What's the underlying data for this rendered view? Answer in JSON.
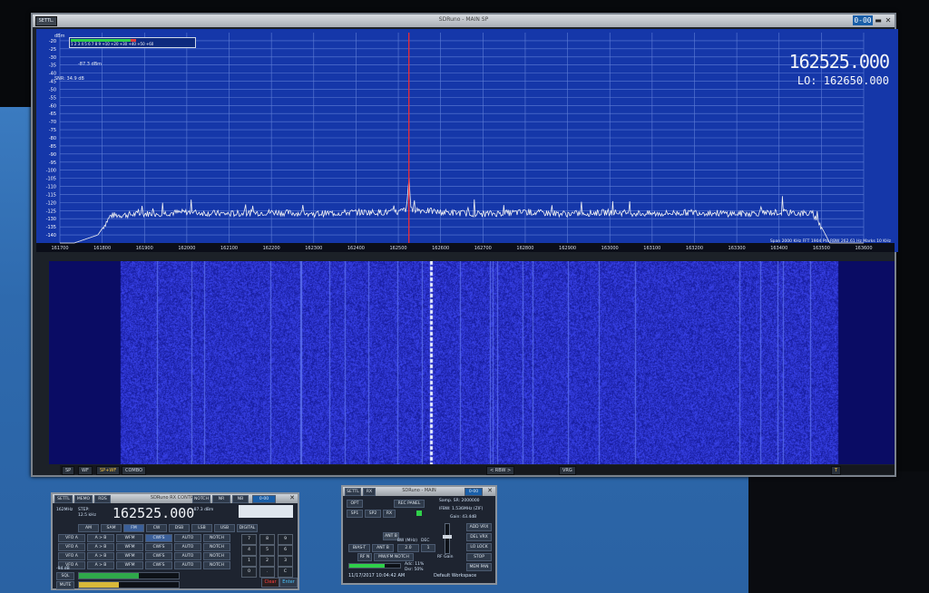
{
  "main_window": {
    "setup_label": "SETTL.",
    "title": "SDRuno - MAIN SP",
    "clock": "0-00",
    "center_freq": "162525.000",
    "lo_freq": "LO: 162650.000",
    "signal_dbm": "-87.3 dBm",
    "snr": "SNR: 34.9 dB",
    "smeter_label": "dBm",
    "smeter_scale": "1 2 3 4 5 6 7 8 9 +10 +20 +30 +40 +50 +60",
    "spectrum_info": "Span 2000 KHz   FFT 1904 Pts   RBW 262.61 Hz   Marks 10 KHz",
    "status": {
      "sp": "SP",
      "wf": "WF",
      "spwf": "SP+WF",
      "combo": "COMBO",
      "rbw": "< RBW >",
      "vrg": "VRG",
      "sp_mode": "SP+WF",
      "extra": "T"
    }
  },
  "chart_data": {
    "type": "line",
    "title": "",
    "xlabel": "",
    "ylabel": "dBm",
    "x_ticks": [
      161700,
      161800,
      161900,
      162000,
      162100,
      162200,
      162300,
      162400,
      162500,
      162600,
      162700,
      162800,
      162900,
      163000,
      163100,
      163200,
      163300,
      163400,
      163500,
      163600
    ],
    "y_ticks": [
      -20,
      -25,
      -30,
      -35,
      -40,
      -45,
      -50,
      -55,
      -60,
      -65,
      -70,
      -75,
      -80,
      -85,
      -90,
      -95,
      -100,
      -105,
      -110,
      -115,
      -120,
      -125,
      -130,
      -135,
      -140
    ],
    "xlim": [
      161700,
      163600
    ],
    "ylim": [
      -145,
      -15
    ],
    "marker_khz": 162525,
    "series": [
      {
        "values_desc": "",
        "x": [
          161700,
          161790,
          161820,
          161900,
          162000,
          162100,
          162200,
          162300,
          162400,
          162500,
          162520,
          162525,
          162530,
          162600,
          162700,
          162800,
          162900,
          163000,
          163100,
          163200,
          163300,
          163400,
          163480,
          163500,
          163520
        ],
        "y": [
          -148,
          -140,
          -128,
          -127,
          -126,
          -127,
          -126,
          -127,
          -126,
          -126,
          -124,
          -105,
          -124,
          -126,
          -127,
          -126,
          -127,
          -126,
          -127,
          -126,
          -127,
          -126,
          -127,
          -135,
          -145
        ]
      }
    ],
    "grid": true
  },
  "rx_panel": {
    "title": "SDRuno RX CONTROL",
    "tabs": [
      "SETTL",
      "MEMO",
      "RDS"
    ],
    "buttons": [
      "NOTCH",
      "NR",
      "NB"
    ],
    "clock": "0-00",
    "freq": "162525.000",
    "vfo_label": "162MHz",
    "step_label": "STEP:",
    "step_value": "12.5 kHz",
    "dbm": "-87.3 dBm",
    "modes": [
      "AM",
      "SAM",
      "FM",
      "CW",
      "DSB",
      "LSB",
      "USB",
      "DIGITAL"
    ],
    "rows": [
      "VFO A",
      "A > B",
      "WFM",
      "CWFS",
      "AUTO",
      "NOTCH"
    ],
    "sql_label": "SQL",
    "vol_label": "MUTE",
    "level": "-94 dB",
    "keypad": [
      "7",
      "8",
      "9",
      "4",
      "5",
      "6",
      "1",
      "2",
      "3",
      "0",
      ".",
      "C"
    ],
    "clear_label": "Clear",
    "enter_label": "Enter"
  },
  "main_panel": {
    "title": "SDRuno - MAIN",
    "tabs": [
      "SETTL",
      "RX"
    ],
    "clock": "0-00",
    "buttons": [
      "OPT",
      "REC PANEL",
      "SP1",
      "SP2",
      "RX"
    ],
    "sample_rate": "Samp. SR: 2000000",
    "ifbw": "IFBW: 1.536MHz (ZIF)",
    "gain": "Gain: 43.4dB",
    "side_buttons": [
      "ADD VRX",
      "DEL VRX",
      "LO LOCK",
      "STOP",
      "MEM PAN"
    ],
    "bias_t": "BIAS-T",
    "ant": "ANT B",
    "bw_label": "BW (MHz)",
    "dec_label": "DEC",
    "bw_value": "2.0",
    "dec_value": "1",
    "mw_notch": "MW/FM NOTCH",
    "rf_gain": "RF Gain",
    "rf_notch": "RF N",
    "adc1": "Adc: 11%",
    "adc2": "Dsr: 50%",
    "datetime": "11/17/2017 10:04:42 AM",
    "workspace": "Default Workspace"
  },
  "colors": {
    "spectrum_bg": "#1537a9",
    "marker": "#ff2a2a",
    "trace": "#f2f2f2",
    "waterfall": "#0c0f6d"
  }
}
